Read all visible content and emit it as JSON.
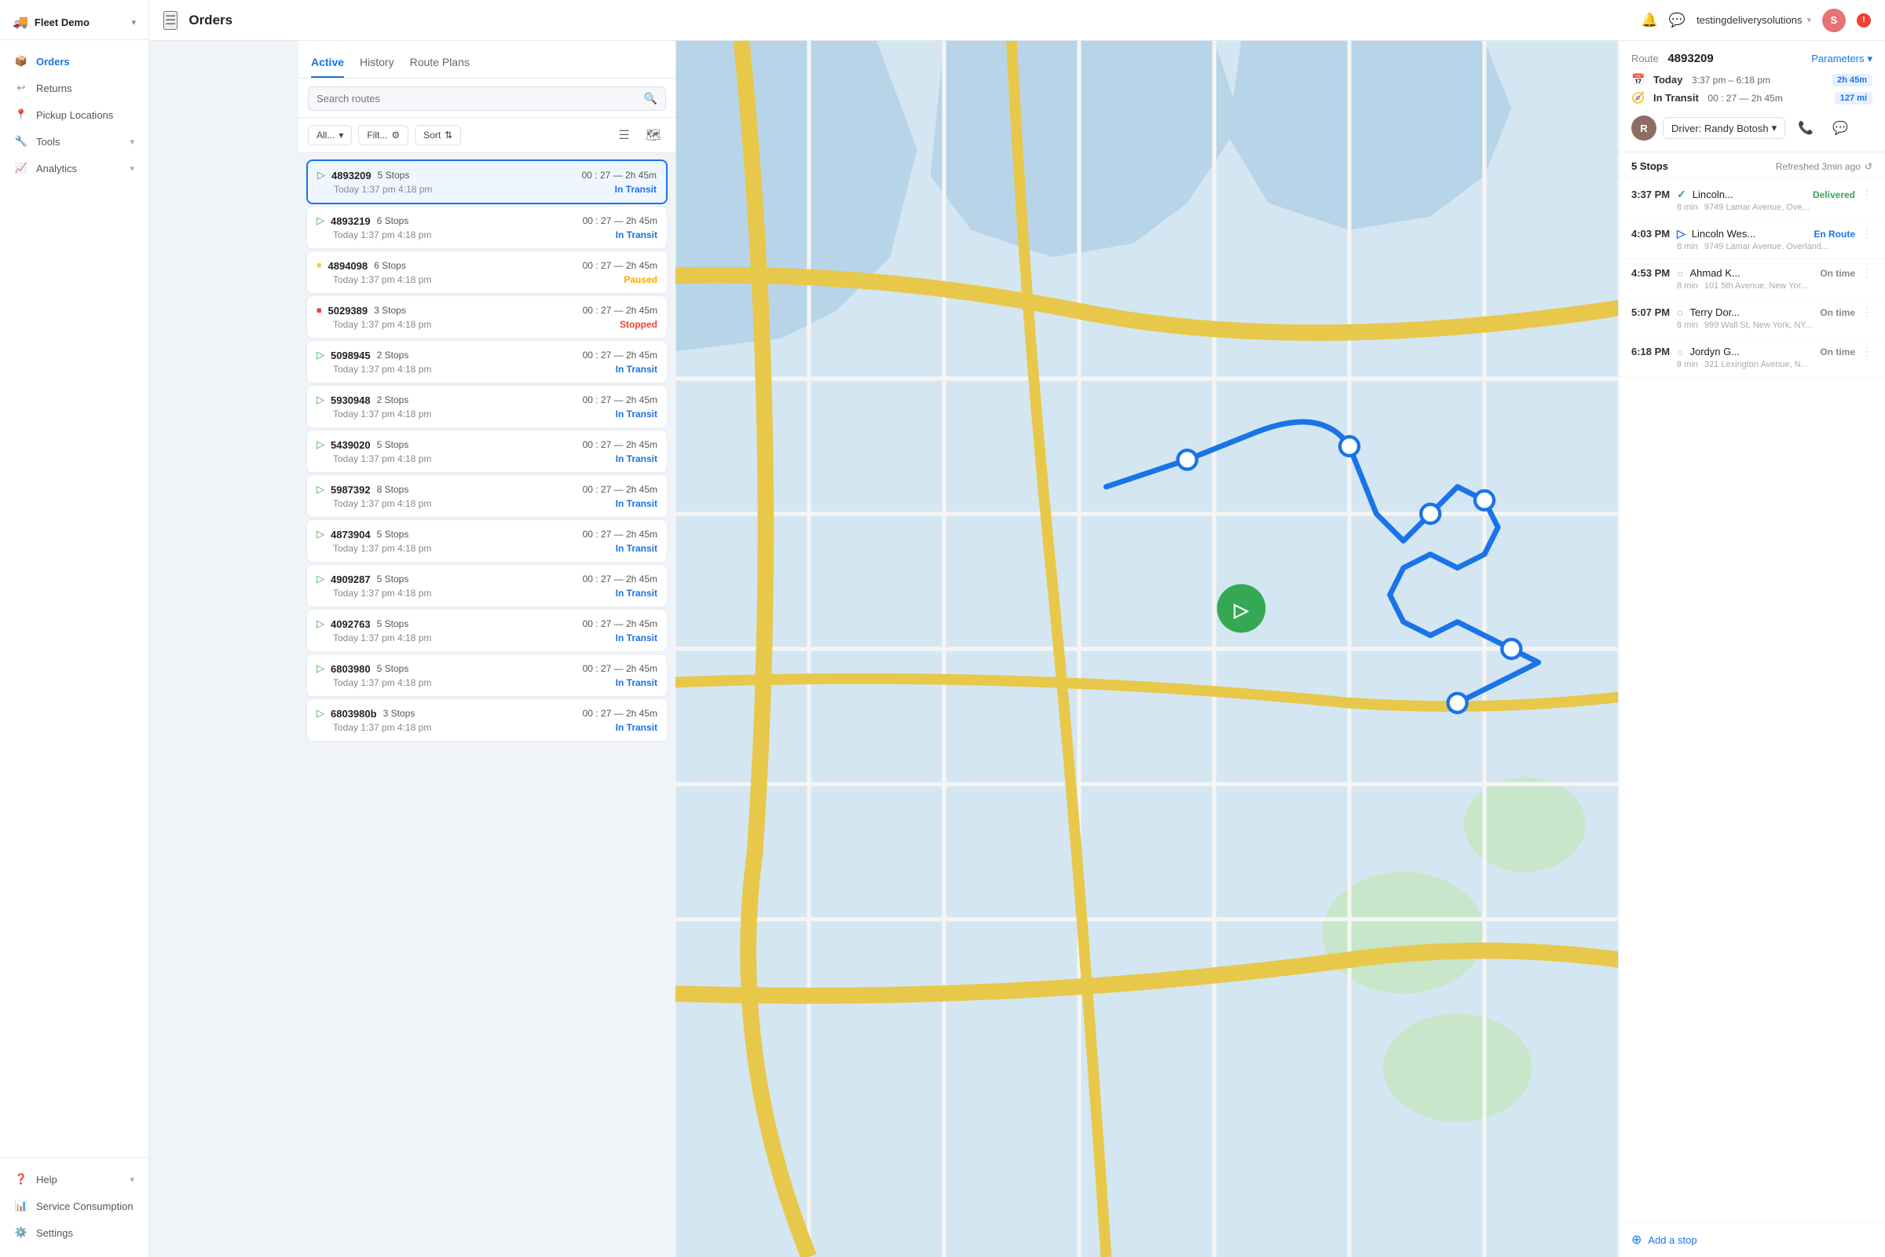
{
  "app": {
    "title": "Orders"
  },
  "header": {
    "menu_icon": "☰",
    "title": "Orders",
    "notification_icon": "🔔",
    "chat_icon": "💬",
    "user": "testingdeliverysolutions",
    "user_chevron": "▾",
    "avatar_label": "S"
  },
  "sidebar": {
    "logo": "Fleet Demo",
    "logo_chevron": "▾",
    "items": [
      {
        "id": "orders",
        "icon": "📦",
        "label": "Orders",
        "active": true
      },
      {
        "id": "returns",
        "icon": "↩",
        "label": "Returns",
        "active": false
      },
      {
        "id": "pickup",
        "icon": "📍",
        "label": "Pickup Locations",
        "active": false
      },
      {
        "id": "tools",
        "icon": "🔧",
        "label": "Tools",
        "active": false,
        "has_chevron": true
      },
      {
        "id": "analytics",
        "icon": "📈",
        "label": "Analytics",
        "active": false,
        "has_chevron": true
      }
    ],
    "bottom": [
      {
        "id": "help",
        "icon": "❓",
        "label": "Help",
        "has_chevron": true
      },
      {
        "id": "service",
        "icon": "📊",
        "label": "Service Consumption",
        "active": false
      },
      {
        "id": "settings",
        "icon": "⚙️",
        "label": "Settings",
        "active": false
      }
    ]
  },
  "route_panel": {
    "tabs": [
      {
        "id": "active",
        "label": "Active",
        "active": true
      },
      {
        "id": "history",
        "label": "History",
        "active": false
      },
      {
        "id": "route_plans",
        "label": "Route Plans",
        "active": false
      }
    ],
    "search_placeholder": "Search routes",
    "filters": {
      "all_label": "All...",
      "filter_label": "Filt...",
      "sort_label": "Sort"
    },
    "routes": [
      {
        "id": "4893209",
        "stops": "5 Stops",
        "time": "00 : 27 — 2h 45m",
        "date": "Today 1:37 pm 4:18 pm",
        "status": "In Transit",
        "status_type": "in-transit",
        "icon_type": "green",
        "selected": true
      },
      {
        "id": "4893219",
        "stops": "6 Stops",
        "time": "00 : 27 — 2h 45m",
        "date": "Today 1:37 pm 4:18 pm",
        "status": "In Transit",
        "status_type": "in-transit",
        "icon_type": "green",
        "selected": false
      },
      {
        "id": "4894098",
        "stops": "6 Stops",
        "time": "00 : 27 — 2h 45m",
        "date": "Today 1:37 pm 4:18 pm",
        "status": "Paused",
        "status_type": "paused",
        "icon_type": "yellow",
        "selected": false
      },
      {
        "id": "5029389",
        "stops": "3 Stops",
        "time": "00 : 27 — 2h 45m",
        "date": "Today 1:37 pm 4:18 pm",
        "status": "Stopped",
        "status_type": "stopped",
        "icon_type": "red",
        "selected": false
      },
      {
        "id": "5098945",
        "stops": "2 Stops",
        "time": "00 : 27 — 2h 45m",
        "date": "Today 1:37 pm 4:18 pm",
        "status": "In Transit",
        "status_type": "in-transit",
        "icon_type": "green",
        "selected": false
      },
      {
        "id": "5930948",
        "stops": "2 Stops",
        "time": "00 : 27 — 2h 45m",
        "date": "Today 1:37 pm 4:18 pm",
        "status": "In Transit",
        "status_type": "in-transit",
        "icon_type": "green",
        "selected": false
      },
      {
        "id": "5439020",
        "stops": "5 Stops",
        "time": "00 : 27 — 2h 45m",
        "date": "Today 1:37 pm 4:18 pm",
        "status": "In Transit",
        "status_type": "in-transit",
        "icon_type": "green",
        "selected": false
      },
      {
        "id": "5987392",
        "stops": "8 Stops",
        "time": "00 : 27 — 2h 45m",
        "date": "Today 1:37 pm 4:18 pm",
        "status": "In Transit",
        "status_type": "in-transit",
        "icon_type": "green",
        "selected": false
      },
      {
        "id": "4873904",
        "stops": "5 Stops",
        "time": "00 : 27 — 2h 45m",
        "date": "Today 1:37 pm 4:18 pm",
        "status": "In Transit",
        "status_type": "in-transit",
        "icon_type": "green",
        "selected": false
      },
      {
        "id": "4909287",
        "stops": "5 Stops",
        "time": "00 : 27 — 2h 45m",
        "date": "Today 1:37 pm 4:18 pm",
        "status": "In Transit",
        "status_type": "in-transit",
        "icon_type": "green",
        "selected": false
      },
      {
        "id": "4092763",
        "stops": "5 Stops",
        "time": "00 : 27 — 2h 45m",
        "date": "Today 1:37 pm 4:18 pm",
        "status": "In Transit",
        "status_type": "in-transit",
        "icon_type": "green",
        "selected": false
      },
      {
        "id": "6803980",
        "stops": "5 Stops",
        "time": "00 : 27 — 2h 45m",
        "date": "Today 1:37 pm 4:18 pm",
        "status": "In Transit",
        "status_type": "in-transit",
        "icon_type": "green",
        "selected": false
      },
      {
        "id": "6803980b",
        "stops": "3 Stops",
        "time": "00 : 27 — 2h 45m",
        "date": "Today 1:37 pm 4:18 pm",
        "status": "In Transit",
        "status_type": "in-transit",
        "icon_type": "green",
        "selected": false
      }
    ]
  },
  "detail_panel": {
    "route_label": "Route",
    "route_id": "4893209",
    "params_label": "Parameters",
    "today_label": "Today",
    "today_time": "3:37 pm – 6:18 pm",
    "today_duration": "2h 45m",
    "transit_label": "In Transit",
    "transit_time": "00 : 27 — 2h 45m",
    "transit_distance": "127 mi",
    "driver_name": "Driver: Randy Botosh",
    "driver_chevron": "▾",
    "phone_icon": "📞",
    "message_icon": "💬",
    "stops_count": "5 Stops",
    "refreshed_text": "Refreshed 3min ago",
    "refresh_icon": "↺",
    "stops": [
      {
        "time": "3:37 PM",
        "icon": "✓",
        "icon_type": "delivered",
        "name": "Lincoln...",
        "status": "Delivered",
        "status_type": "delivered",
        "duration": "8 min",
        "address": "9749 Lamar Avenue, Ove..."
      },
      {
        "time": "4:03 PM",
        "icon": "▷",
        "icon_type": "en-route",
        "name": "Lincoln Wes...",
        "status": "En Route",
        "status_type": "en-route",
        "duration": "8 min",
        "address": "9749 Lamar Avenue, Overland..."
      },
      {
        "time": "4:53 PM",
        "icon": "○",
        "icon_type": "on-time",
        "name": "Ahmad K...",
        "status": "On time",
        "status_type": "on-time",
        "duration": "8 min",
        "address": "101 5th Avenue, New Yor..."
      },
      {
        "time": "5:07 PM",
        "icon": "○",
        "icon_type": "on-time",
        "name": "Terry Dor...",
        "status": "On time",
        "status_type": "on-time",
        "duration": "8 min",
        "address": "999 Wall St, New York, NY..."
      },
      {
        "time": "6:18 PM",
        "icon": "○",
        "icon_type": "on-time",
        "name": "Jordyn G...",
        "status": "On time",
        "status_type": "on-time",
        "duration": "8 min",
        "address": "321 Lexington Avenue, N..."
      }
    ],
    "add_stop_label": "Add a stop"
  }
}
